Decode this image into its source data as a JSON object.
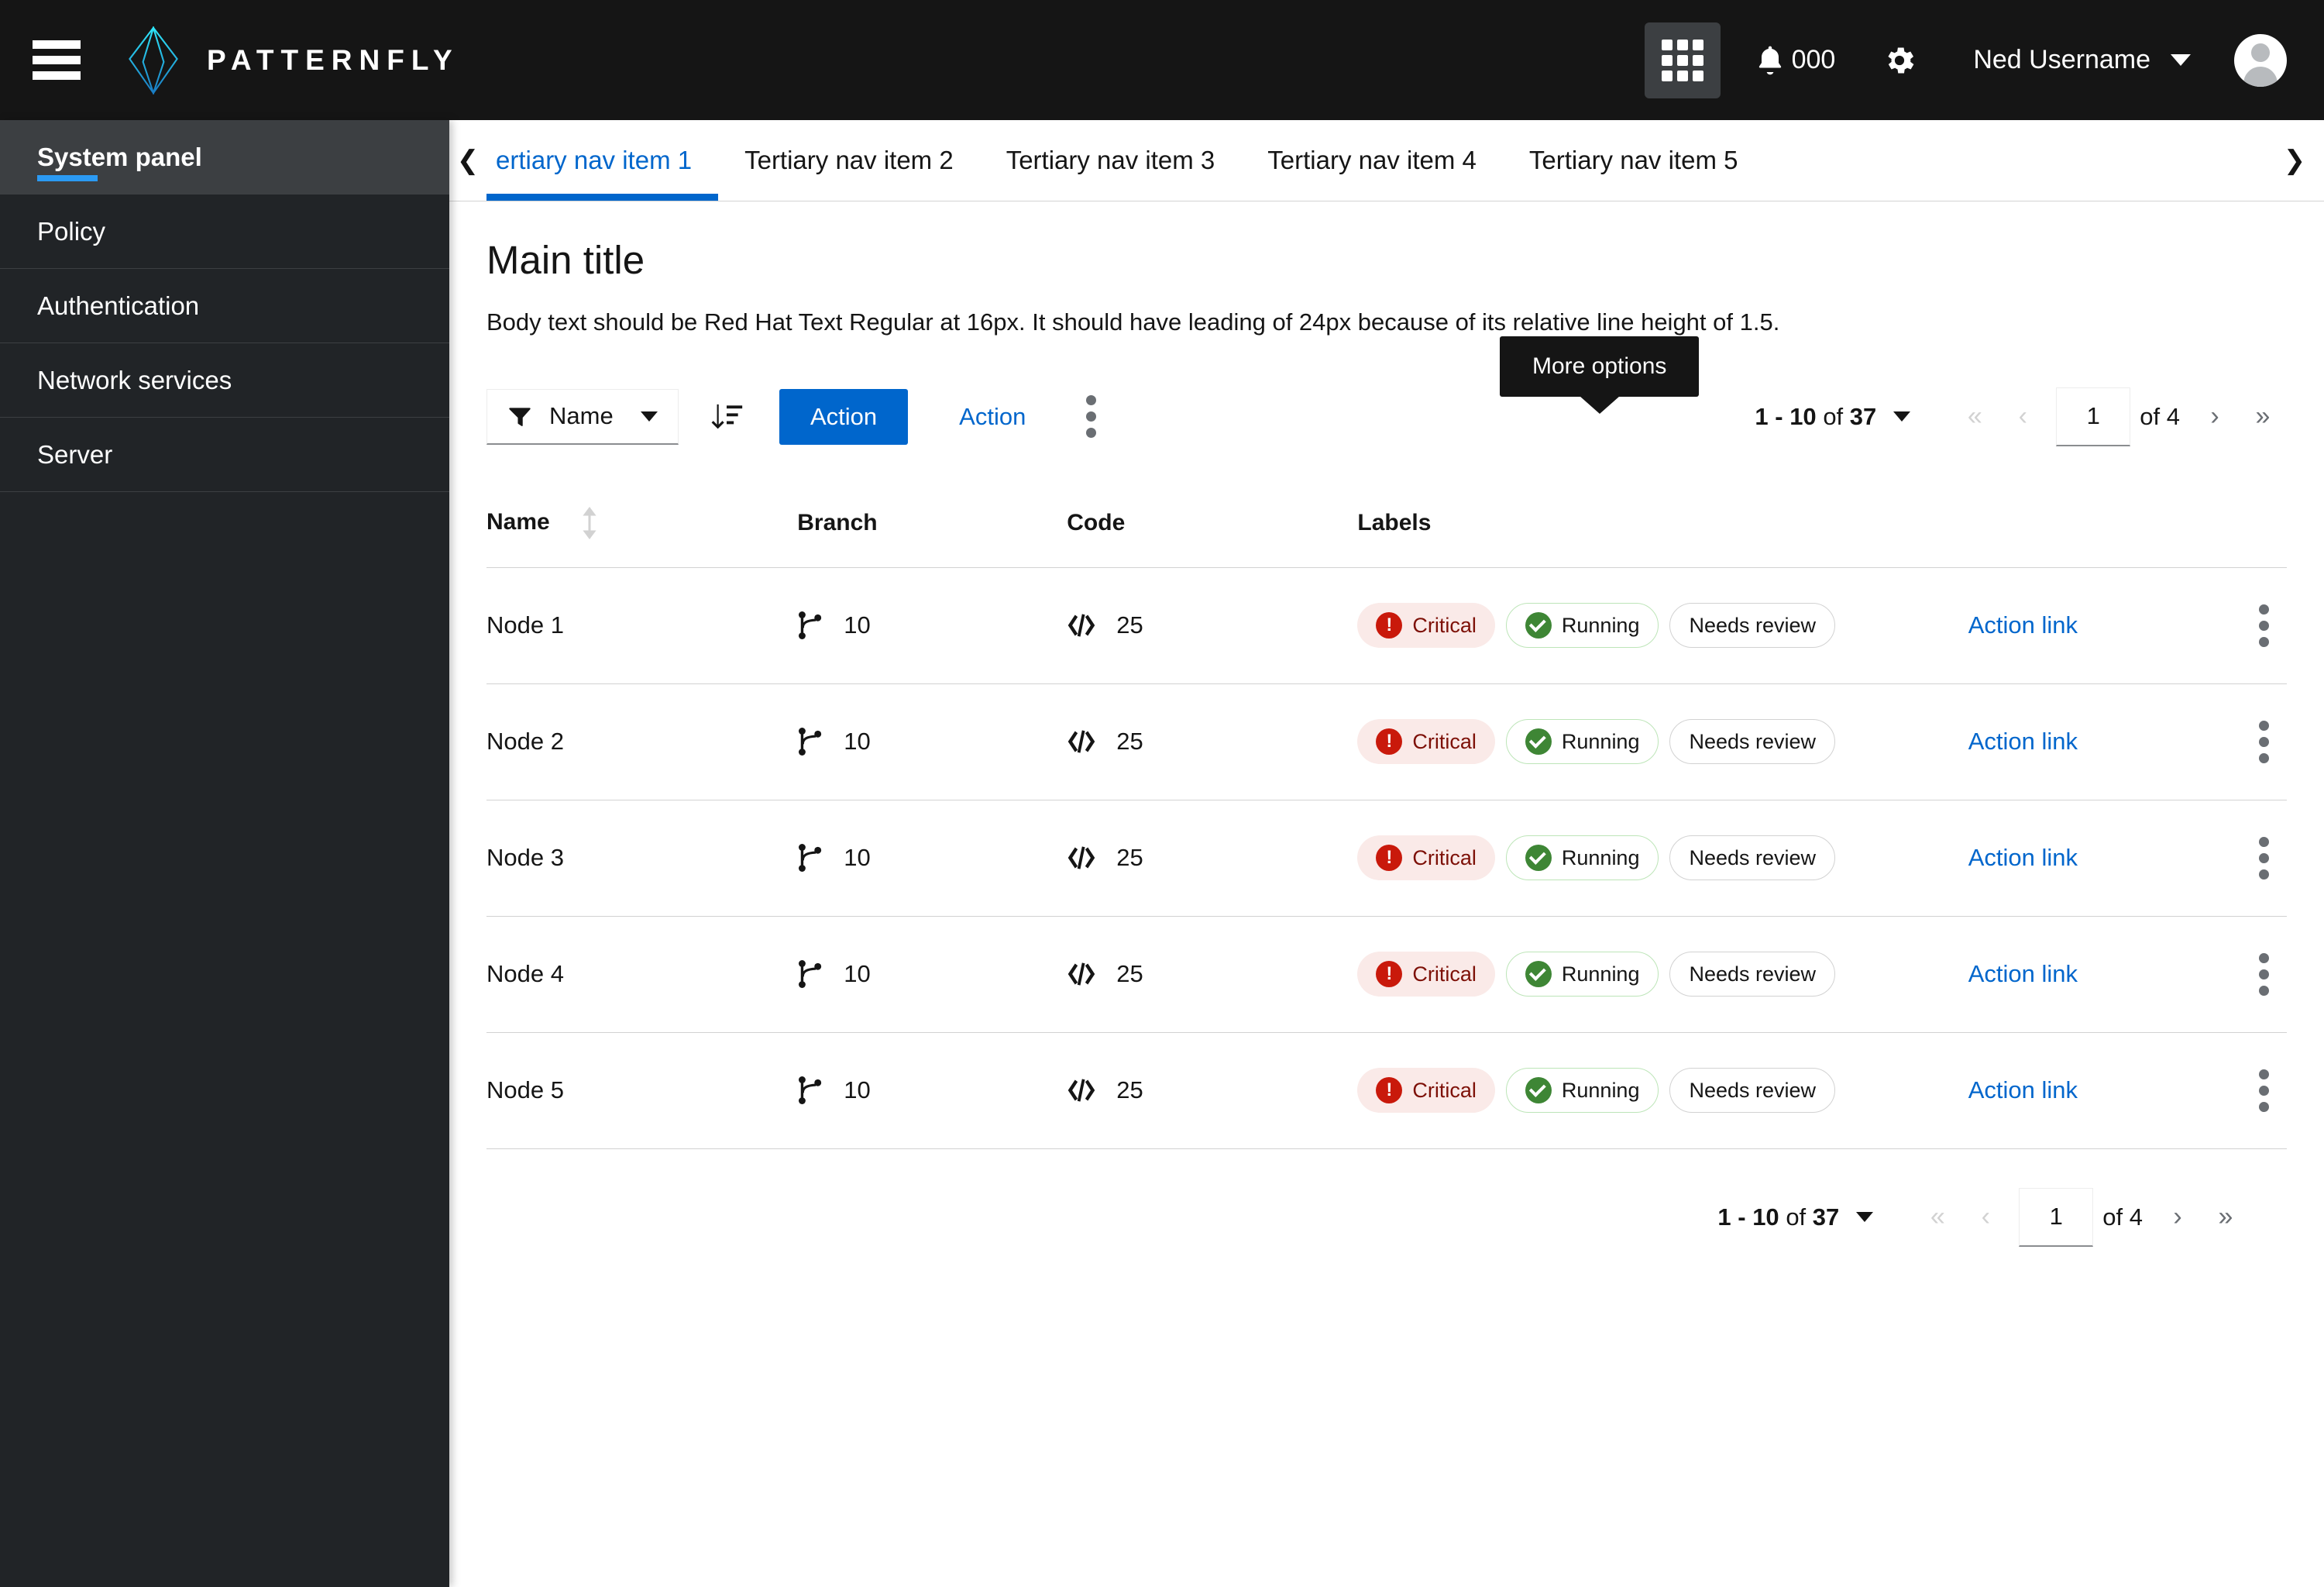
{
  "masthead": {
    "hamburger_icon": "hamburger-menu-icon",
    "brand_name": "PATTERNFLY",
    "logo_icon": "patternfly-logo-icon",
    "grid_icon": "app-launcher-grid-icon",
    "bell_icon": "notification-bell-icon",
    "notification_count": "000",
    "gear_icon": "settings-gear-icon",
    "user_name": "Ned Username",
    "caret_icon": "chevron-down-icon",
    "avatar_icon": "user-avatar-icon"
  },
  "sidebar": {
    "items": [
      {
        "label": "System panel",
        "active": true
      },
      {
        "label": "Policy",
        "active": false
      },
      {
        "label": "Authentication",
        "active": false
      },
      {
        "label": "Network services",
        "active": false
      },
      {
        "label": "Server",
        "active": false
      }
    ]
  },
  "tertiary_nav": {
    "scroll_left_icon": "chevron-left-icon",
    "scroll_right_icon": "chevron-right-icon",
    "tabs": [
      {
        "label": "ertiary nav item 1",
        "active": true
      },
      {
        "label": "Tertiary nav item 2",
        "active": false
      },
      {
        "label": "Tertiary nav item 3",
        "active": false
      },
      {
        "label": "Tertiary nav item 4",
        "active": false
      },
      {
        "label": "Tertiary nav item 5",
        "active": false
      }
    ]
  },
  "content": {
    "title": "Main title",
    "body_text": "Body text should be Red Hat Text Regular at 16px. It should have leading of 24px because of its relative line height of 1.5."
  },
  "toolbar": {
    "filter_icon": "filter-funnel-icon",
    "filter_label": "Name",
    "filter_caret_icon": "caret-down-icon",
    "sort_icon": "sort-amount-down-icon",
    "primary_action_label": "Action",
    "link_action_label": "Action",
    "kebab_icon": "kebab-vertical-icon",
    "tooltip_text": "More options"
  },
  "pagination": {
    "summary_range": "1 - 10",
    "summary_of": "of",
    "summary_total": "37",
    "options_caret_icon": "caret-down-icon",
    "first_icon": "angle-double-left-icon",
    "prev_icon": "angle-left-icon",
    "page_value": "1",
    "of_pages": "of 4",
    "next_icon": "angle-right-icon",
    "last_icon": "angle-double-right-icon"
  },
  "table": {
    "columns": [
      {
        "key": "name",
        "label": "Name",
        "sortable": true,
        "sort_icon": "sort-updown-icon"
      },
      {
        "key": "branch",
        "label": "Branch",
        "sortable": false
      },
      {
        "key": "code",
        "label": "Code",
        "sortable": false
      },
      {
        "key": "labels",
        "label": "Labels",
        "sortable": false
      }
    ],
    "branch_icon": "code-branch-icon",
    "code_icon": "code-brackets-icon",
    "row_action_label": "Action link",
    "row_kebab_icon": "kebab-vertical-icon",
    "rows": [
      {
        "name": "Node 1",
        "branch": "10",
        "code": "25",
        "labels": [
          {
            "text": "Critical",
            "style": "critical",
            "icon": "exclamation-circle-icon"
          },
          {
            "text": "Running",
            "style": "running",
            "icon": "check-circle-icon"
          },
          {
            "text": "Needs review",
            "style": "plain",
            "icon": ""
          }
        ]
      },
      {
        "name": "Node 2",
        "branch": "10",
        "code": "25",
        "labels": [
          {
            "text": "Critical",
            "style": "critical",
            "icon": "exclamation-circle-icon"
          },
          {
            "text": "Running",
            "style": "running",
            "icon": "check-circle-icon"
          },
          {
            "text": "Needs review",
            "style": "plain",
            "icon": ""
          }
        ]
      },
      {
        "name": "Node 3",
        "branch": "10",
        "code": "25",
        "labels": [
          {
            "text": "Critical",
            "style": "critical",
            "icon": "exclamation-circle-icon"
          },
          {
            "text": "Running",
            "style": "running",
            "icon": "check-circle-icon"
          },
          {
            "text": "Needs review",
            "style": "plain",
            "icon": ""
          }
        ]
      },
      {
        "name": "Node 4",
        "branch": "10",
        "code": "25",
        "labels": [
          {
            "text": "Critical",
            "style": "critical",
            "icon": "exclamation-circle-icon"
          },
          {
            "text": "Running",
            "style": "running",
            "icon": "check-circle-icon"
          },
          {
            "text": "Needs review",
            "style": "plain",
            "icon": ""
          }
        ]
      },
      {
        "name": "Node 5",
        "branch": "10",
        "code": "25",
        "labels": [
          {
            "text": "Critical",
            "style": "critical",
            "icon": "exclamation-circle-icon"
          },
          {
            "text": "Running",
            "style": "running",
            "icon": "check-circle-icon"
          },
          {
            "text": "Needs review",
            "style": "plain",
            "icon": ""
          }
        ]
      }
    ]
  },
  "colors": {
    "masthead_bg": "#151515",
    "sidebar_bg": "#212427",
    "sidebar_active_bg": "#3c3f42",
    "accent_blue": "#0066cc",
    "nav_accent": "#2b9af3",
    "danger_red": "#c9190b",
    "success_green": "#3e8635",
    "border_gray": "#d2d2d2"
  }
}
